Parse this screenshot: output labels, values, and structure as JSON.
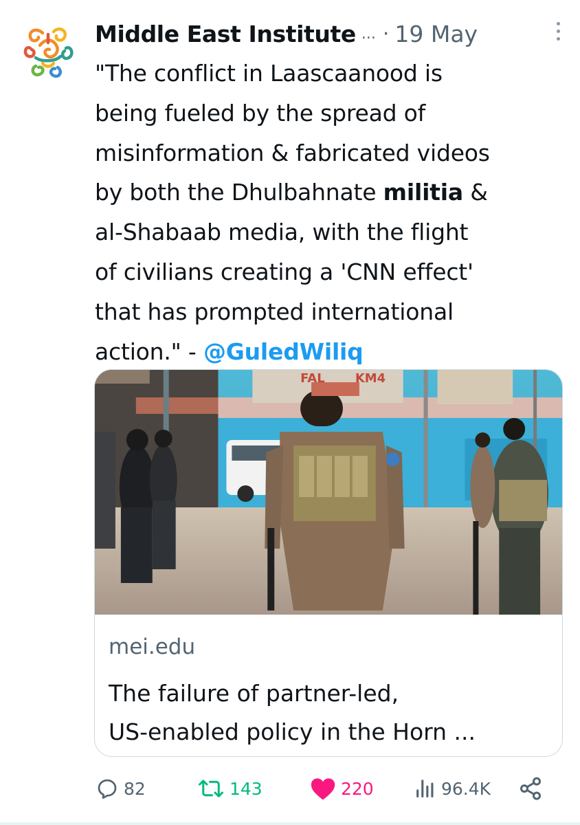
{
  "tweet": {
    "author_name": "Middle East Institute",
    "author_ellipsis": "...",
    "separator": "·",
    "date": "19 May",
    "text_lines": [
      "\"The conflict in Laascaanood is",
      "being fueled by the spread of",
      "misinformation & fabricated videos"
    ],
    "text_line4_before": "by both the Dhulbahnate ",
    "text_line4_bold": "militia",
    "text_line4_after": " &",
    "text_lines_more": [
      "al-Shabaab media, with the flight",
      "of civilians creating a 'CNN effect'",
      "that has prompted international"
    ],
    "text_last_before": "action.\" - ",
    "mention": "@GuledWiliq"
  },
  "card": {
    "sign_left": "FAL",
    "sign_right": "KM4",
    "domain": "mei.edu",
    "title_line1": "The failure of partner-led,",
    "title_line2": "US-enabled policy in the Horn ..."
  },
  "actions": {
    "replies": "82",
    "retweets": "143",
    "likes": "220",
    "views": "96.4K"
  },
  "colors": {
    "accent": "#1d9bf0",
    "retweet": "#00ba7c",
    "like": "#f91880",
    "muted": "#536471",
    "border": "#cfd9de"
  },
  "icons": [
    "logo-icon",
    "more-icon",
    "reply-icon",
    "retweet-icon",
    "like-icon",
    "views-icon",
    "share-icon"
  ]
}
